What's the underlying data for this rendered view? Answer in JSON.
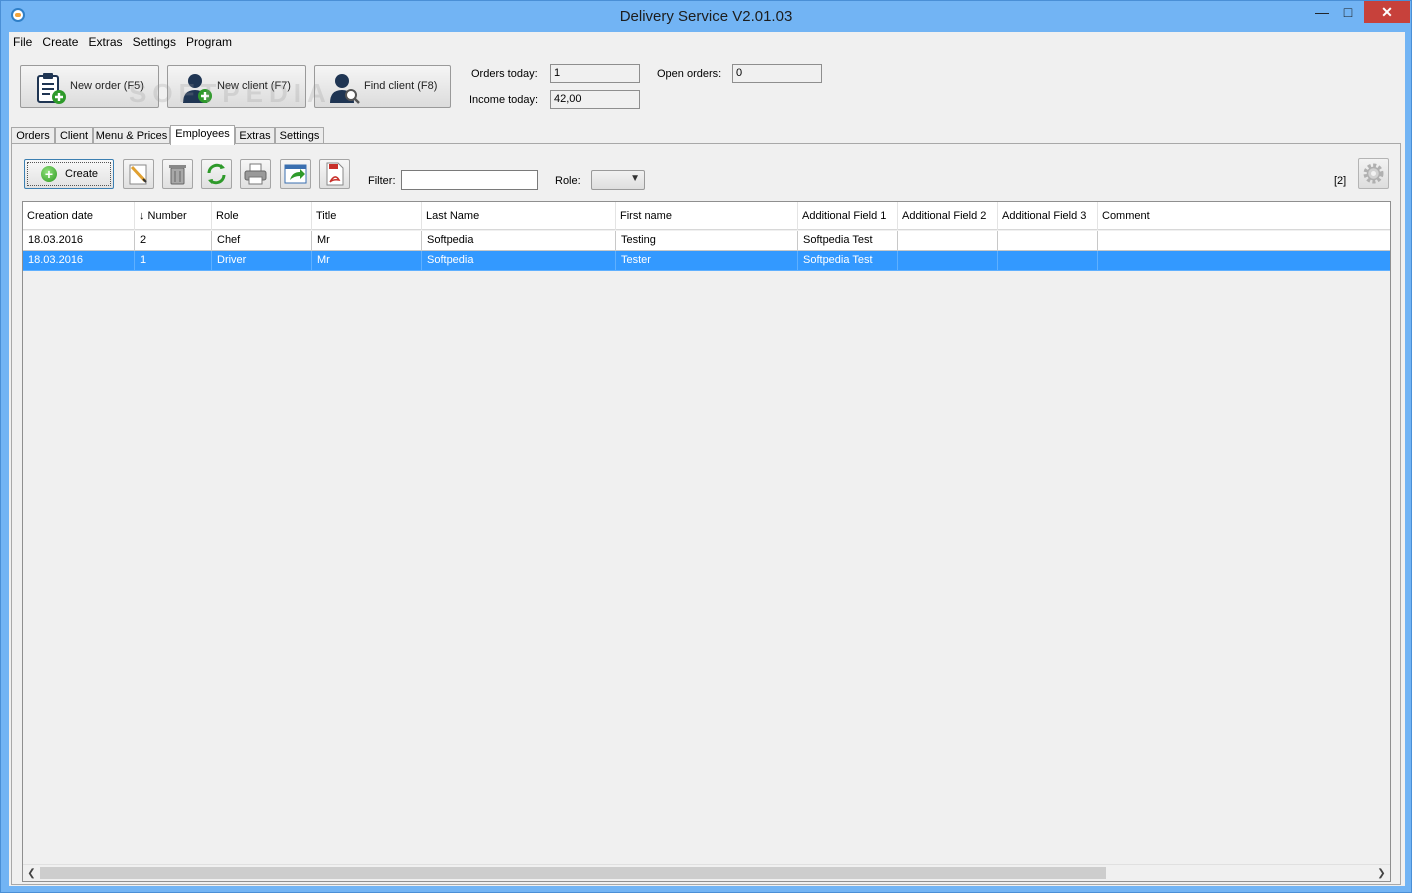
{
  "window": {
    "title": "Delivery Service V2.01.03",
    "controls": {
      "minimize": "—",
      "maximize": "□",
      "close": "✕"
    }
  },
  "menu": [
    "File",
    "Create",
    "Extras",
    "Settings",
    "Program"
  ],
  "quick_buttons": {
    "new_order": "New order (F5)",
    "new_client": "New client (F7)",
    "find_client": "Find client (F8)"
  },
  "stats": {
    "orders_today_label": "Orders today:",
    "orders_today_value": "1",
    "income_today_label": "Income today:",
    "income_today_value": "42,00",
    "open_orders_label": "Open orders:",
    "open_orders_value": "0"
  },
  "tabs": [
    {
      "label": "Orders",
      "active": false
    },
    {
      "label": "Client",
      "active": false
    },
    {
      "label": "Menu & Prices",
      "active": false
    },
    {
      "label": "Employees",
      "active": true
    },
    {
      "label": "Extras",
      "active": false
    },
    {
      "label": "Settings",
      "active": false
    }
  ],
  "toolbar": {
    "create_label": "Create",
    "filter_label": "Filter:",
    "filter_value": "",
    "role_label": "Role:",
    "role_value": "",
    "count": "[2]"
  },
  "table": {
    "columns": [
      "Creation date",
      "↓ Number",
      "Role",
      "Title",
      "Last Name",
      "First name",
      "Additional Field 1",
      "Additional Field 2",
      "Additional Field 3",
      "Comment"
    ],
    "rows": [
      [
        "18.03.2016",
        "2",
        "Chef",
        "Mr",
        "Softpedia",
        "Testing",
        "Softpedia Test",
        "",
        "",
        ""
      ],
      [
        "18.03.2016",
        "1",
        "Driver",
        "Mr",
        "Softpedia",
        "Tester",
        "Softpedia Test",
        "",
        "",
        ""
      ]
    ],
    "selected_row": 1
  },
  "colors": {
    "titlebar": "#72b4f4",
    "selection": "#3399ff",
    "close_button": "#c7413b"
  },
  "watermark": "SOFTPEDIA"
}
